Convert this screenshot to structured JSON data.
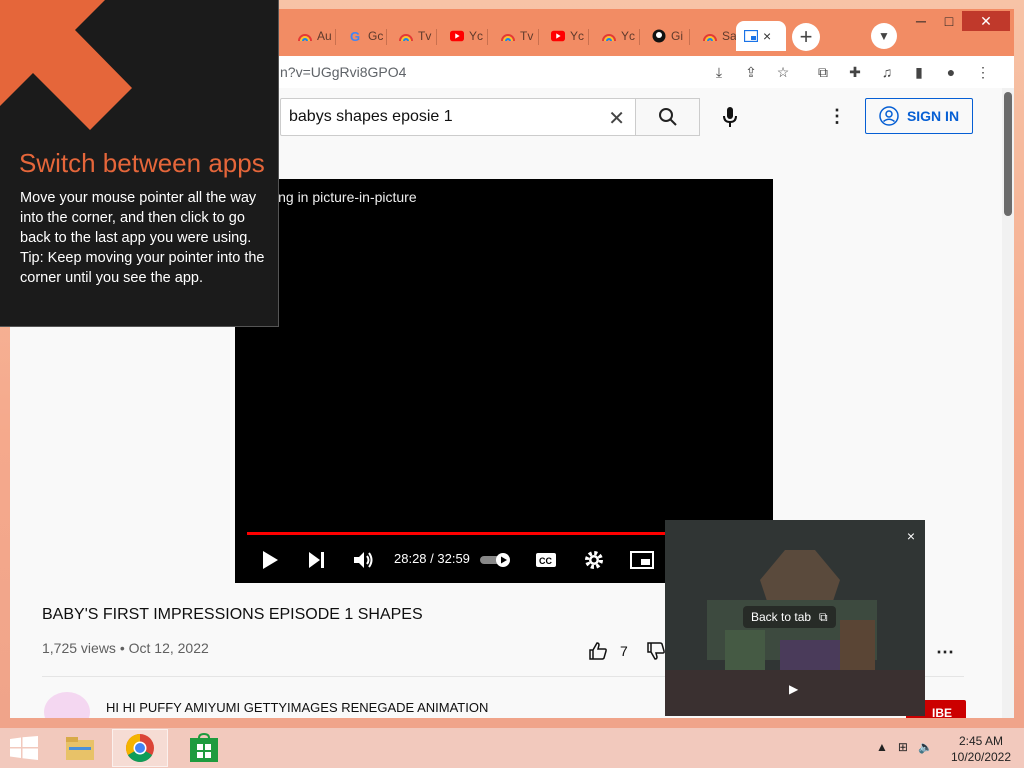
{
  "browser": {
    "tabs": [
      {
        "label": "Au",
        "icon": "rainbow-favicon"
      },
      {
        "label": "Gc",
        "icon": "google-favicon"
      },
      {
        "label": "Tv",
        "icon": "rainbow-favicon"
      },
      {
        "label": "Yc",
        "icon": "youtube-favicon"
      },
      {
        "label": "Tv",
        "icon": "rainbow-favicon"
      },
      {
        "label": "Yc",
        "icon": "youtube-favicon"
      },
      {
        "label": "Yc",
        "icon": "rainbow-favicon"
      },
      {
        "label": "Gi",
        "icon": "github-favicon"
      },
      {
        "label": "Sa",
        "icon": "rainbow-favicon"
      }
    ],
    "active_tab_close": "×",
    "new_tab": "+",
    "url": "n?v=UGgRvi8GPO4",
    "window_controls": {
      "minimize": "─",
      "maximize": "□",
      "close": "✕"
    }
  },
  "youtube": {
    "search_query": "babys shapes eposie 1",
    "sign_in_label": "SIGN IN",
    "player_message": "ing in picture-in-picture",
    "time": "28:28 / 32:59",
    "video_title": "BABY'S FIRST IMPRESSIONS EPISODE 1 SHAPES",
    "views_date": "1,725 views • Oct 12, 2022",
    "likes": "7",
    "channel": "HI HI PUFFY AMIYUMI GETTYIMAGES RENEGADE ANIMATION",
    "subscribe_partial": "IBE"
  },
  "pip": {
    "back_to_tab": "Back to tab",
    "close": "×"
  },
  "overlay": {
    "title": "Switch between apps",
    "body_lines": [
      "Move your mouse pointer all the way into the corner, and then click to go back to the last app you were using.",
      "Tip: Keep moving your pointer into the corner until you see the app."
    ]
  },
  "taskbar": {
    "time": "2:45 AM",
    "date": "10/20/2022"
  },
  "colors": {
    "accent": "#f28c64",
    "overlay_title": "#e5663a",
    "youtube_red": "#ff0000",
    "signin_blue": "#065fd4"
  }
}
